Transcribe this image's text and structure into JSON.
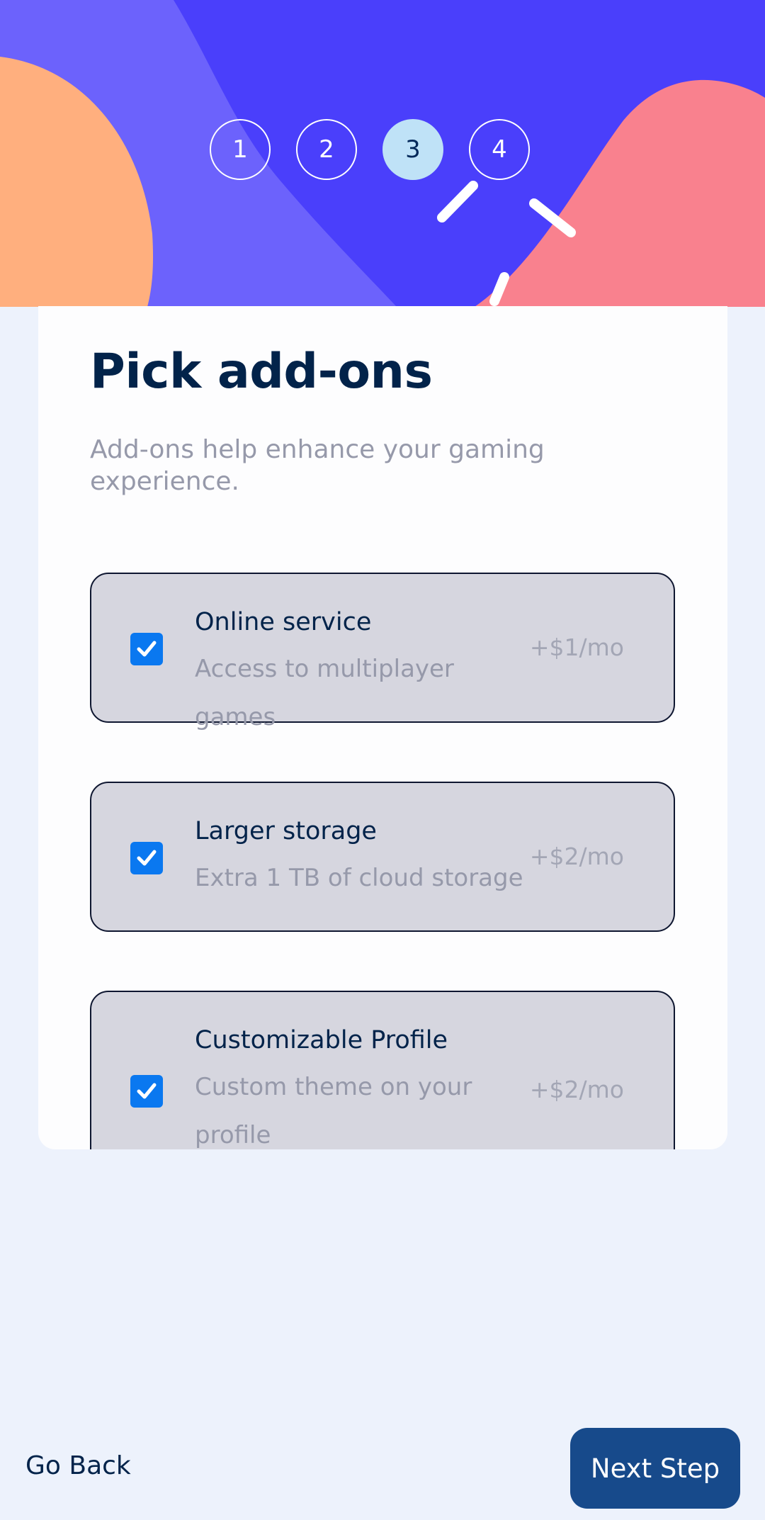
{
  "steps": [
    "1",
    "2",
    "3",
    "4"
  ],
  "current_step": 3,
  "card": {
    "title": "Pick add-ons",
    "subtitle": "Add-ons help enhance your gaming experience."
  },
  "addons": [
    {
      "name": "Online service",
      "description": "Access to multiplayer games",
      "price": "+$1/mo",
      "checked": true
    },
    {
      "name": "Larger storage",
      "description": "Extra 1 TB of cloud storage",
      "price": "+$2/mo",
      "checked": true
    },
    {
      "name": "Customizable Profile",
      "description": "Custom theme on your profile",
      "price": "+$2/mo",
      "checked": true
    }
  ],
  "footer": {
    "back_label": "Go Back",
    "next_label": "Next Step"
  },
  "colors": {
    "hero_blue": "#4a3ffb",
    "hero_violet": "#6c62fc",
    "hero_orange": "#ffaf7e",
    "hero_pink": "#f9818e",
    "active_step": "#bfe2f7",
    "checkbox": "#0a78f0",
    "next_button": "#174a8b",
    "page_bg": "#edf2fc"
  }
}
